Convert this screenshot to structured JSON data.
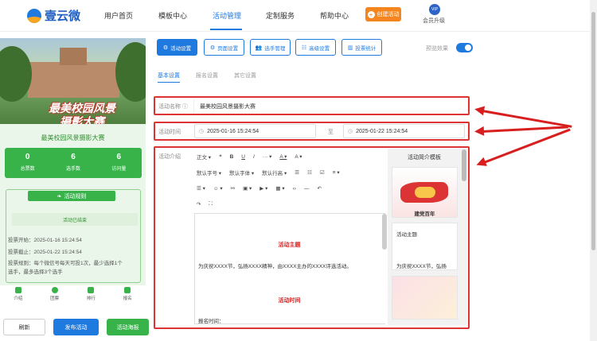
{
  "nav": {
    "logo_text": "壹云微",
    "items": [
      "用户首页",
      "模板中心",
      "活动管理",
      "定制服务",
      "帮助中心"
    ],
    "create_label": "创建活动",
    "vip_badge": "VIP",
    "vip_label": "会员升级"
  },
  "poster": {
    "title_line1": "最美校园风景",
    "title_line2": "摄影大赛"
  },
  "left": {
    "activity_name": "最美校园风景摄影大赛",
    "stats": [
      {
        "num": "0",
        "label": "总票数"
      },
      {
        "num": "6",
        "label": "选手数"
      },
      {
        "num": "6",
        "label": "访问量"
      }
    ],
    "rules_head": "活动规则",
    "ended": "活动已结束",
    "vote_start": "投票开始：2025-01-16 15:24:54",
    "vote_end": "投票截止：2025-01-22 15:24:54",
    "vote_rule": "投票规则：每个微信号每天可投1次，最少选择1个选手，最多选择3个选手",
    "tabs": [
      "介绍",
      "团票",
      "排行",
      "报名"
    ],
    "btn_refresh": "刷新",
    "btn_publish": "发布活动",
    "btn_poster": "活动海报"
  },
  "toolbar": {
    "buttons": [
      "活动设置",
      "页面设置",
      "选手管理",
      "高级设置",
      "投票统计"
    ],
    "preview_label": "预览效果"
  },
  "subtabs": [
    "基本设置",
    "报名设置",
    "其它设置"
  ],
  "form": {
    "name_label": "活动名称 ⓘ",
    "name_value": "最美校园风景摄影大赛",
    "time_label": "活动时间",
    "start": "2025-01-16 15:24:54",
    "to": "至",
    "end": "2025-01-22 15:24:54",
    "intro_label": "活动介绍"
  },
  "editor": {
    "row1": [
      "正文 ▾",
      "❝",
      "B",
      "U",
      "I",
      "··· ▾",
      "A ▾",
      "A ▾"
    ],
    "row2": [
      "默认字号 ▾",
      "默认字体 ▾",
      "默认行高 ▾",
      "☰",
      "☷",
      "☑",
      "≡ ▾"
    ],
    "row3": [
      "☰ ▾",
      "☺ ▾",
      "⚯",
      "▣ ▾",
      "▶ ▾",
      "▦ ▾",
      "‹›",
      "—",
      "↶"
    ],
    "row4": [
      "↷",
      "⛶"
    ],
    "heading1": "活动主题",
    "para1": "为庆祝XXXX节，弘扬XXXX精神，由XXXX主办的XXXX评选活动。",
    "heading2": "活动时间",
    "para2": "报名时间："
  },
  "templates": {
    "title": "活动简介模板",
    "card1_caption": "建党百年",
    "card2_title": "活动主题",
    "card2_text": "为庆祝XXXX节，弘扬"
  }
}
